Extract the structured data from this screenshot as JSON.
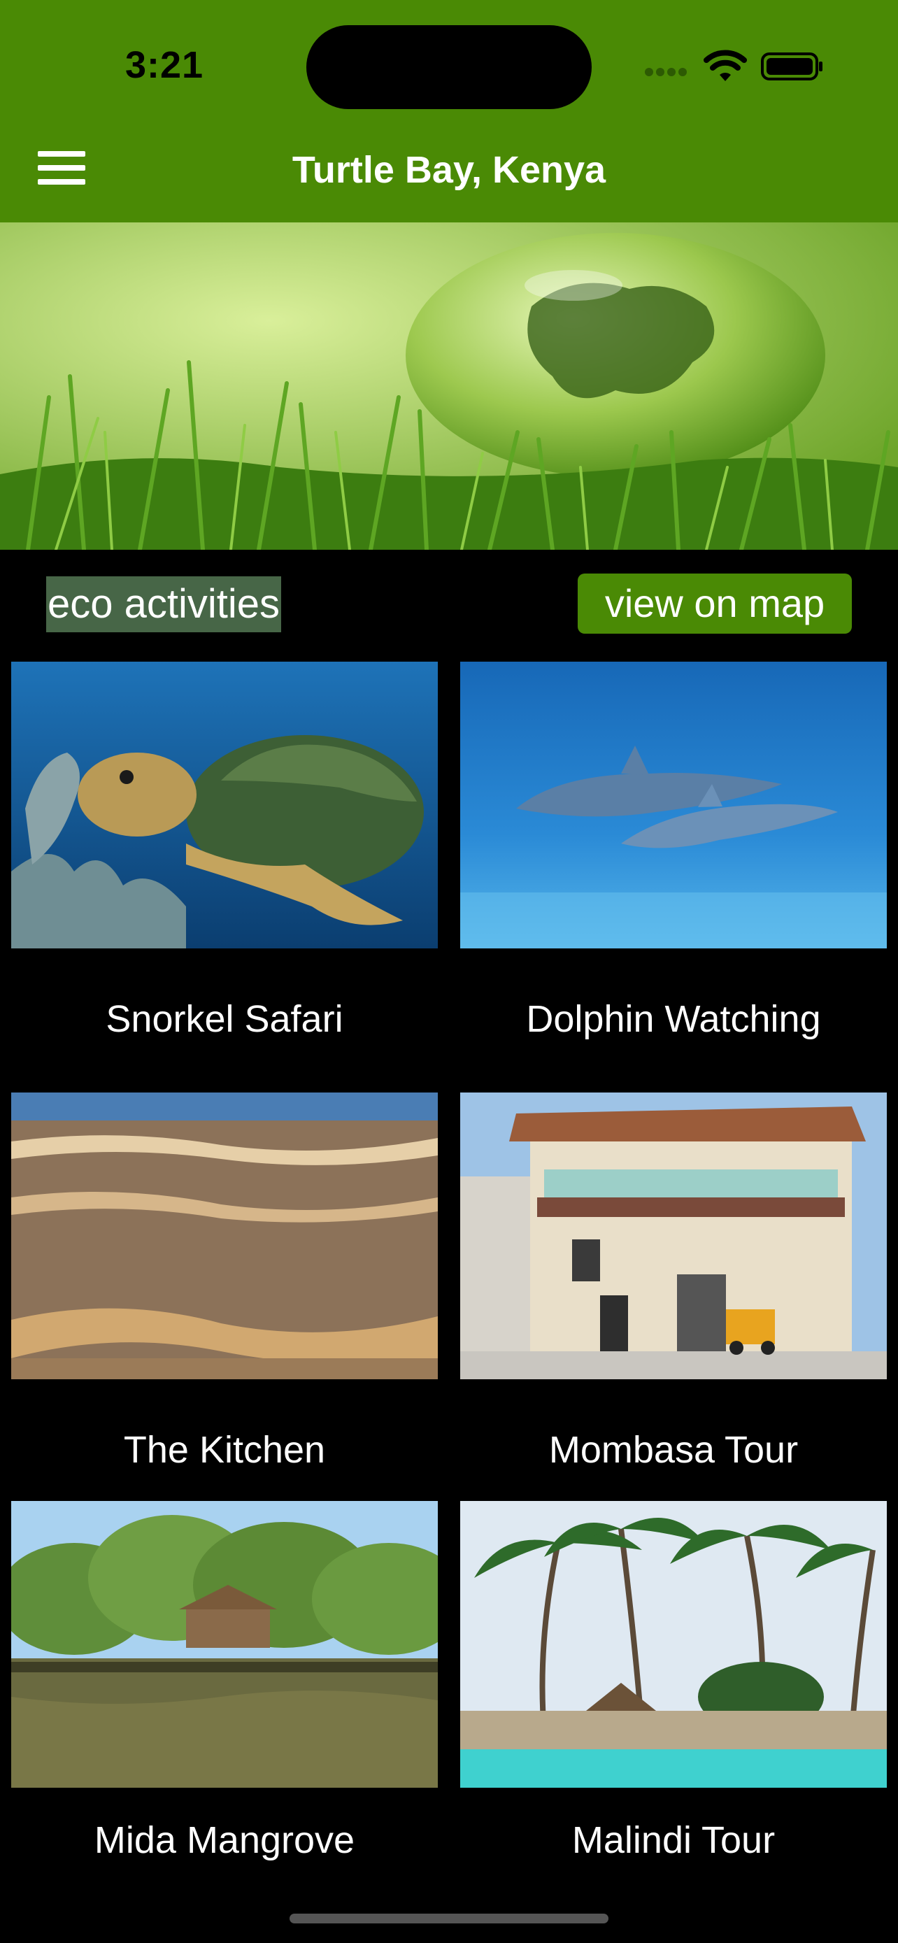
{
  "status": {
    "time": "3:21"
  },
  "nav": {
    "title": "Turtle Bay, Kenya"
  },
  "section": {
    "label": "eco activities",
    "map_button": "view on map"
  },
  "activities": [
    {
      "name": "Snorkel Safari"
    },
    {
      "name": "Dolphin Watching"
    },
    {
      "name": "The Kitchen"
    },
    {
      "name": "Mombasa Tour"
    },
    {
      "name": "Mida Mangrove"
    },
    {
      "name": "Malindi Tour"
    }
  ],
  "colors": {
    "brand_green": "#4a8a05",
    "label_bg": "#476647",
    "background": "#000000"
  }
}
